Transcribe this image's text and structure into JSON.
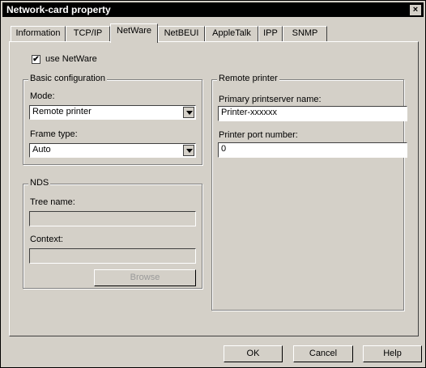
{
  "window": {
    "title": "Network-card property",
    "close_glyph": "×"
  },
  "tabs": [
    {
      "label": "Information"
    },
    {
      "label": "TCP/IP"
    },
    {
      "label": "NetWare"
    },
    {
      "label": "NetBEUI"
    },
    {
      "label": "AppleTalk"
    },
    {
      "label": "IPP"
    },
    {
      "label": "SNMP"
    }
  ],
  "active_tab": "NetWare",
  "use_netware": {
    "label": "use NetWare",
    "checked": true,
    "mark": "✔"
  },
  "basic_config": {
    "title": "Basic configuration",
    "mode_label": "Mode:",
    "mode_value": "Remote printer",
    "frame_label": "Frame type:",
    "frame_value": "Auto"
  },
  "nds": {
    "title": "NDS",
    "tree_label": "Tree name:",
    "tree_value": "",
    "context_label": "Context:",
    "context_value": "",
    "browse_label": "Browse"
  },
  "remote_printer": {
    "title": "Remote printer",
    "server_label": "Primary printserver name:",
    "server_value": "Printer-xxxxxx",
    "port_label": "Printer port number:",
    "port_value": "0"
  },
  "buttons": {
    "ok": "OK",
    "cancel": "Cancel",
    "help": "Help"
  }
}
